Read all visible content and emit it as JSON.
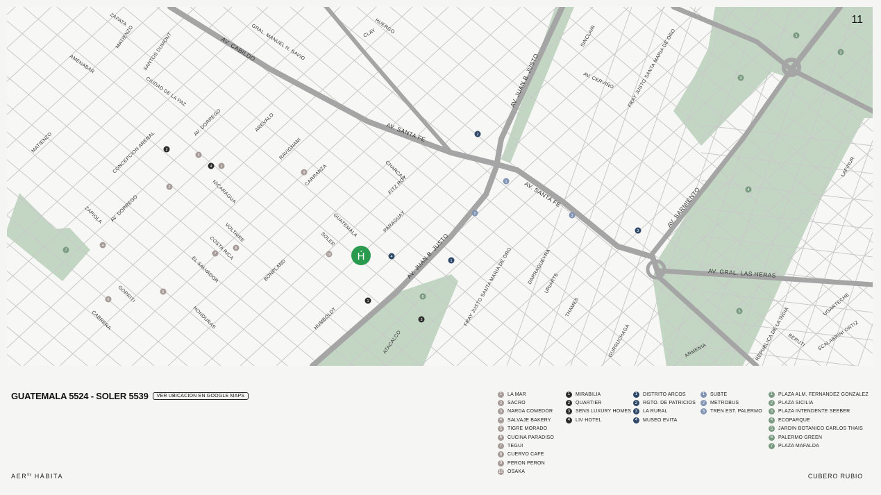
{
  "page": {
    "number": "11"
  },
  "project": {
    "address": "GUATEMALA 5524 - SOLER 5539",
    "maps_button": "VER UBICACION EN GOOGLE MAPS"
  },
  "footer": {
    "brand_left": "AER",
    "brand_left_sup": "by",
    "brand_left_tail": "HÁBITA",
    "brand_right": "CUBERO RUBIO"
  },
  "colors": {
    "gastronomy": "#a79b98",
    "hotels": "#2c2c2c",
    "culture": "#2e4868",
    "transport": "#8193b3",
    "parks": "#7a9b82",
    "project_marker": "#2a9a4e",
    "park_fill": "#c2d6c3",
    "avenue": "#a5a5a5",
    "street": "#c9c9c9"
  },
  "legend": {
    "gastronomy": [
      "LA MAR",
      "SACRO",
      "NARDA COMEDOR",
      "SALVAJE BAKERY",
      "TIGRE MORADO",
      "CUCINA PARADISO",
      "TEGUI",
      "CUERVO CAFE",
      "PERON PERON",
      "OSAKA"
    ],
    "hotels": [
      "MIRABILIA",
      "QUARTIER",
      "SENS LUXURY HOMES",
      "LIV HOTEL"
    ],
    "culture": [
      "DISTRITO ARCOS",
      "RGTO. DE PATRICIOS",
      "LA RURAL",
      "MUSEO EVITA"
    ],
    "transport": [
      "SUBTE",
      "METROBUS",
      "TREN EST. PALERMO"
    ],
    "parks": [
      "PLAZA ALM. FERNANDEZ GONZALEZ",
      "PLAZA SICILIA",
      "PLAZA INTENDENTE SEEBER",
      "ECOPARQUE",
      "JARDIN BOTANICO CARLOS THAIS",
      "PALERMO GREEN",
      "PLAZA MAFALDA"
    ]
  },
  "map": {
    "project_marker_letter": "H́",
    "avenues": {
      "cabildo": "AV. CABILDO",
      "santa_fe_1": "AV. SANTA FE",
      "santa_fe_2": "AV. SANTA FE",
      "juan_b_justo_1": "AV. JUAN B. JUSTO",
      "juan_b_justo_2": "AV. JUAN B. JUSTO",
      "sarmiento": "AV. SARMIENTO",
      "las_heras": "AV. GRAL. LAS HERAS"
    },
    "streets": {
      "zapata": "ZAPATA",
      "matienzo1": "MATIENZO",
      "amenabar": "AMENABAR",
      "santos_dumont": "SANTOS DUMONT",
      "ciudad_de_la_paz": "CIUDAD DE LA PAZ",
      "grl_manuel_savio": "GRAL. MANUEL N. SAVIO",
      "clay": "CLAY",
      "huergo": "HUERGO",
      "av_dorrego1": "AV. DORREGO",
      "arevalo": "AREVALO",
      "ravignani": "RAVIGNANI",
      "carranza": "CARRANZA",
      "charcas": "CHARCAS",
      "fitz_roy": "FITZ ROY",
      "paraguay": "PARAGUAY",
      "guatemala": "GUATEMALA",
      "soler": "SOLER",
      "humboldt": "HUMBOLDT",
      "bonpland": "BONPLAND",
      "nicaragua": "NICARAGUA",
      "voltaire": "VOLTAIRE",
      "costa_rica": "COSTA RICA",
      "el_salvador": "EL SALVADOR",
      "honduras": "HONDURAS",
      "gorriti": "GORRITI",
      "cabrera": "CABRERA",
      "zapiola": "ZAPIOLA",
      "av_dorrego2": "AV. DORREGO",
      "matienzo2": "MATIENZO",
      "concepcion_arenal": "CONCEPCION ARENAL",
      "atacalco": "ATACALCO",
      "fray_justo_1": "FRAY JUSTO SANTA MARIA DE ORO",
      "darragueyra": "DARRAGUEYRA",
      "uriarte": "URIARTE",
      "thames": "THAMES",
      "gurruchaga": "GURRUCHAGA",
      "armenia": "ARMENIA",
      "sinclair": "SINCLAIR",
      "av_cervino": "AV. CERVIÑO",
      "fray_justo_2": "FRAY JUSTO SANTA MARIA DE ORO",
      "lafinur": "LAFINUR",
      "republica_india": "REPUBLICA DE LA INDIA",
      "beruti": "BERUTI",
      "scalabrini": "SCALABRINI ORTIZ",
      "ugarteche": "UGARTECHE"
    }
  }
}
